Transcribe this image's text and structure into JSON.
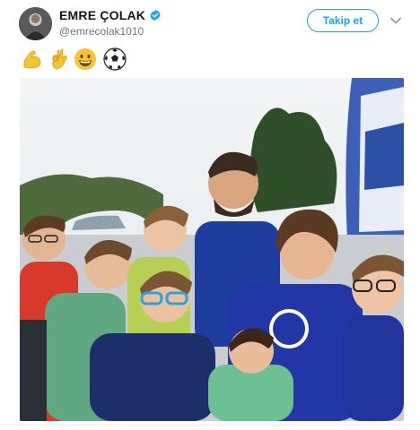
{
  "tweet": {
    "display_name": "EMRE ÇOLAK",
    "handle": "@emrecolak1010",
    "follow_label": "Takip et",
    "emojis": [
      "flexed-biceps",
      "ok-hand",
      "grinning-face",
      "soccer-ball"
    ]
  },
  "colors": {
    "brand_blue": "#1da1f2",
    "handle_gray": "#657786",
    "text": "#14171a"
  },
  "photo": {
    "description_icon": "photo-icon"
  }
}
